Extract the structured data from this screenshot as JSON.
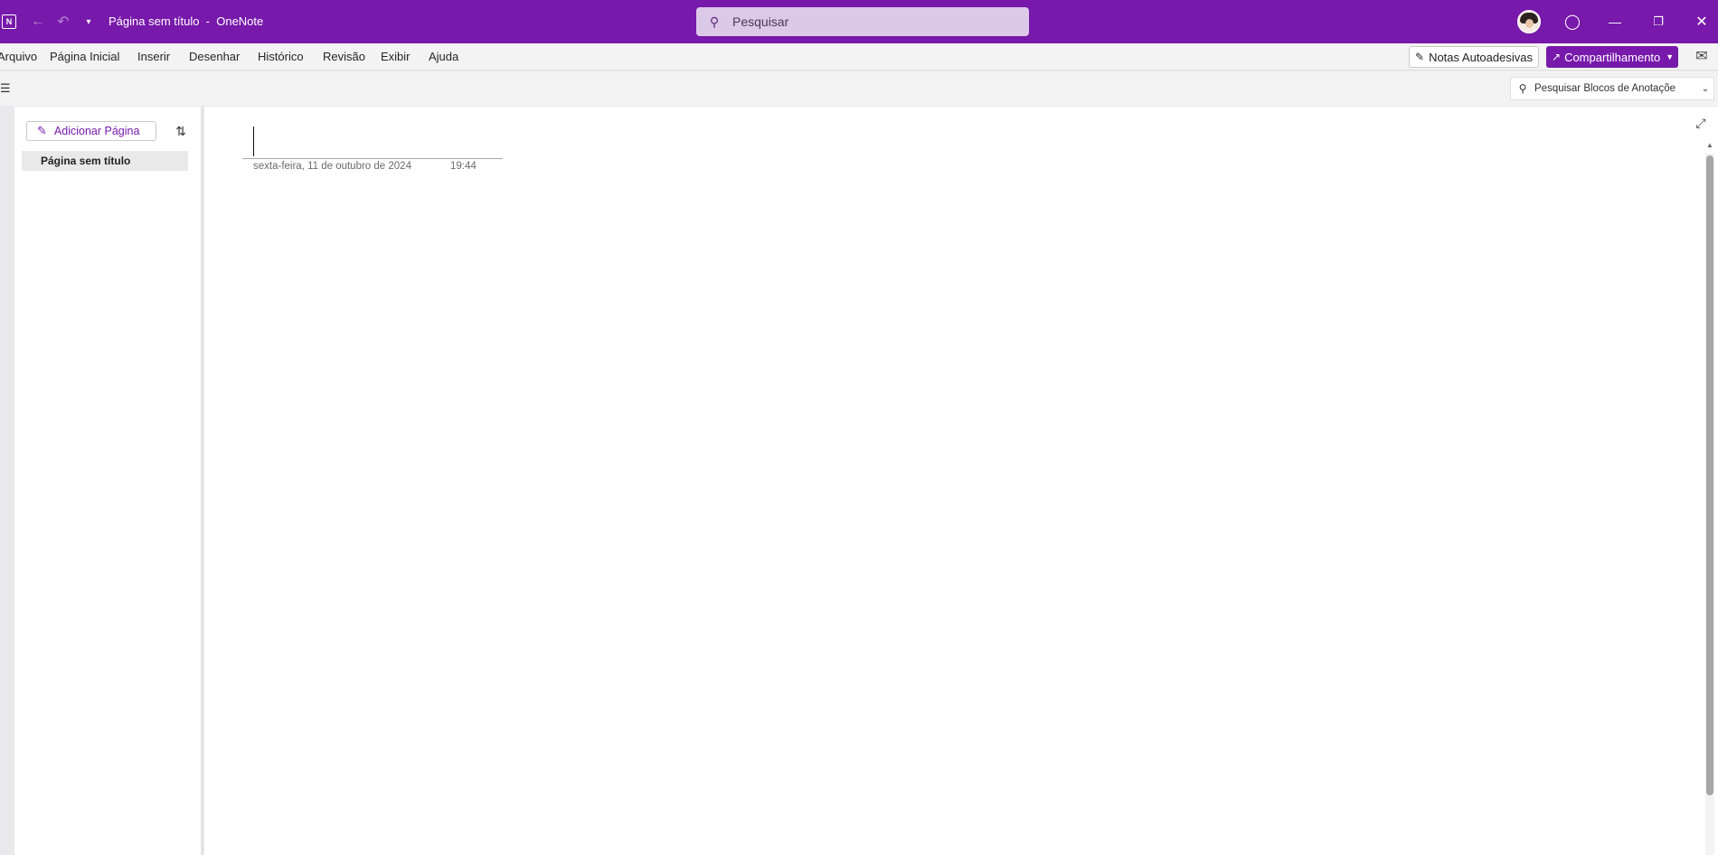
{
  "titlebar": {
    "app_icon": "onenote-logo-icon",
    "app_icon_text": "N",
    "back_icon": "back-arrow-icon",
    "undo_icon": "undo-icon",
    "qat_icon": "chevron-down-icon",
    "title": "Página sem título  -  OneNote",
    "search_placeholder": "Pesquisar",
    "avatar": "user-avatar",
    "lightbulb_icon": "lightbulb-icon",
    "minimize_icon": "minimize-icon",
    "restore_icon": "restore-icon",
    "close_icon": "close-icon",
    "bg_color": "#7719aa"
  },
  "ribbon": {
    "tabs": [
      {
        "label": "Arquivo"
      },
      {
        "label": "Página Inicial"
      },
      {
        "label": "Inserir"
      },
      {
        "label": "Desenhar"
      },
      {
        "label": "Histórico"
      },
      {
        "label": "Revisão"
      },
      {
        "label": "Exibir"
      },
      {
        "label": "Ajuda"
      }
    ],
    "sticky_notes_label": "Notas Autoadesivas",
    "share_label": "Compartilhamento"
  },
  "navbar": {
    "notebook_search_placeholder": "Pesquisar Blocos de Anotaçõe"
  },
  "pages": {
    "add_page_label": "Adicionar Página",
    "items": [
      {
        "title": "Página sem título",
        "selected": true
      }
    ]
  },
  "page": {
    "title": "",
    "date": "sexta-feira, 11 de outubro de 2024",
    "time": "19:44"
  },
  "colors": {
    "accent": "#7719aa",
    "selected_page_bg": "#e9e9e9"
  }
}
